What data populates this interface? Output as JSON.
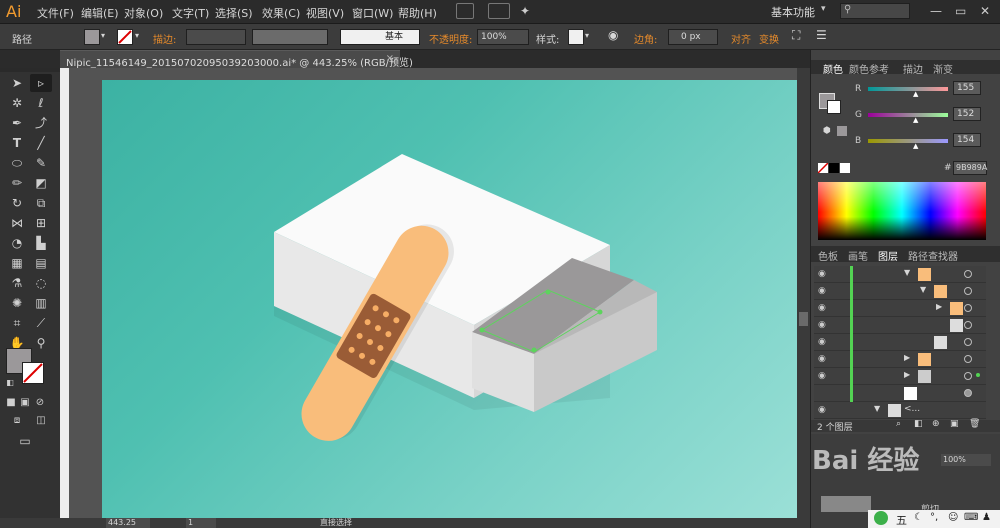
{
  "app": {
    "logo": "Ai"
  },
  "menu": [
    "文件(F)",
    "编辑(E)",
    "对象(O)",
    "文字(T)",
    "选择(S)",
    "效果(C)",
    "视图(V)",
    "窗口(W)",
    "帮助(H)"
  ],
  "workspace": {
    "label": "基本功能",
    "search_placeholder": ""
  },
  "control_bar": {
    "selection_type": "路径",
    "stroke_label": "描边:",
    "stroke_style": "基本",
    "opacity_label": "不透明度:",
    "opacity_value": "100%",
    "style_label": "样式:",
    "corner_label": "边角:",
    "corner_value": "0 px",
    "align_label": "对齐",
    "transform_label": "变换"
  },
  "document_tab": {
    "title": "Nipic_11546149_20150702095039203000.ai* @ 443.25% (RGB/预览)",
    "close": "×"
  },
  "color_panel": {
    "tabs": [
      "颜色",
      "颜色参考",
      "描边",
      "渐变"
    ],
    "channels": [
      {
        "label": "R",
        "value": "155"
      },
      {
        "label": "G",
        "value": "152"
      },
      {
        "label": "B",
        "value": "154"
      }
    ],
    "hex": "9B989A",
    "fill_color": "#9b989a"
  },
  "layers_panel": {
    "tabs": [
      "色板",
      "画笔",
      "图层",
      "路径查找器"
    ],
    "count_label": "2 个图层",
    "bottom_name": "<..."
  },
  "lower_panel": {
    "zoom_value": "100%",
    "cut_label": "剪切"
  },
  "status": {
    "zoom": "443.25",
    "page": "1",
    "tool": "直接选择"
  },
  "watermark": {
    "text": "Bai 经验"
  },
  "taskbar": {
    "ime": "五"
  },
  "colors": {
    "accent_orange": "#e58a2b",
    "layer_green": "#53d353",
    "teal_bg": "#4fc0b1"
  }
}
